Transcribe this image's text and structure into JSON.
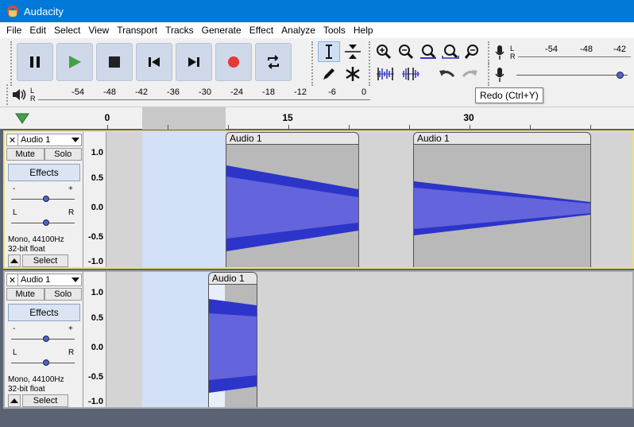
{
  "window": {
    "title": "Audacity"
  },
  "menu": [
    "File",
    "Edit",
    "Select",
    "View",
    "Transport",
    "Tracks",
    "Generate",
    "Effect",
    "Analyze",
    "Tools",
    "Help"
  ],
  "meters": {
    "record_ticks": [
      "-54",
      "-48",
      "-42"
    ],
    "play_ticks": [
      "-54",
      "-48",
      "-42",
      "-36",
      "-30",
      "-24",
      "-18",
      "-12",
      "-6",
      "0"
    ],
    "lr": {
      "l": "L",
      "r": "R"
    },
    "rec_slider_level": 0.97
  },
  "tooltip": "Redo (Ctrl+Y)",
  "timeline": {
    "labels": [
      "0",
      "15",
      "30"
    ]
  },
  "tracks": [
    {
      "name": "Audio 1",
      "mute": "Mute",
      "solo": "Solo",
      "effects": "Effects",
      "gain_minus": "-",
      "gain_plus": "+",
      "pan_l": "L",
      "pan_r": "R",
      "info_rate": "Mono, 44100Hz",
      "info_format": "32-bit float",
      "select": "Select",
      "scale": [
        "1.0",
        "0.5",
        "0.0",
        "-0.5",
        "-1.0"
      ],
      "clips": [
        {
          "name": "Audio 1"
        },
        {
          "name": "Audio 1"
        }
      ]
    },
    {
      "name": "Audio 1",
      "mute": "Mute",
      "solo": "Solo",
      "effects": "Effects",
      "gain_minus": "-",
      "gain_plus": "+",
      "pan_l": "L",
      "pan_r": "R",
      "info_rate": "Mono, 44100Hz",
      "info_format": "32-bit float",
      "select": "Select",
      "scale": [
        "1.0",
        "0.5",
        "0.0",
        "-0.5",
        "-1.0"
      ],
      "clips": [
        {
          "name": "Audio 1"
        }
      ]
    }
  ],
  "colors": {
    "wave_dark": "#2d34c9",
    "wave_light": "#6464dc",
    "selection": "#d2e0f8",
    "record_red": "#e53935",
    "play_green": "#43a047"
  }
}
